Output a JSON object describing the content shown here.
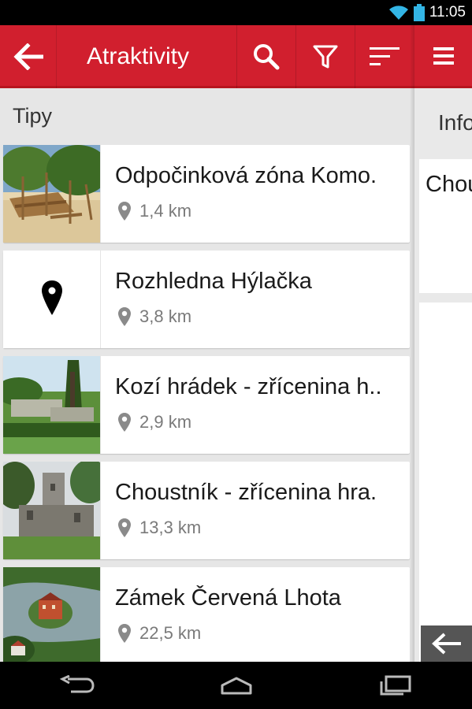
{
  "status_bar": {
    "time": "11:05"
  },
  "action_bar": {
    "title": "Atraktivity"
  },
  "section": {
    "header": "Tipy"
  },
  "items": [
    {
      "title": "Odpočinková zóna Komo.",
      "distance": "1,4 km",
      "thumb": "playground-photo"
    },
    {
      "title": "Rozhledna Hýlačka",
      "distance": "3,8 km",
      "thumb": "map-pin-placeholder"
    },
    {
      "title": "Kozí hrádek - zřícenina h..",
      "distance": "2,9 km",
      "thumb": "castle-ruin-photo"
    },
    {
      "title": "Choustník - zřícenina hra.",
      "distance": "13,3 km",
      "thumb": "castle-tower-photo"
    },
    {
      "title": "Zámek Červená Lhota",
      "distance": "22,5 km",
      "thumb": "chateau-lake-photo"
    }
  ],
  "right_panel": {
    "header": "Info",
    "card_title": "Chou"
  },
  "colors": {
    "brand_red": "#d11f2e",
    "brand_red_dark": "#b7151f",
    "background": "#e6e6e6"
  }
}
